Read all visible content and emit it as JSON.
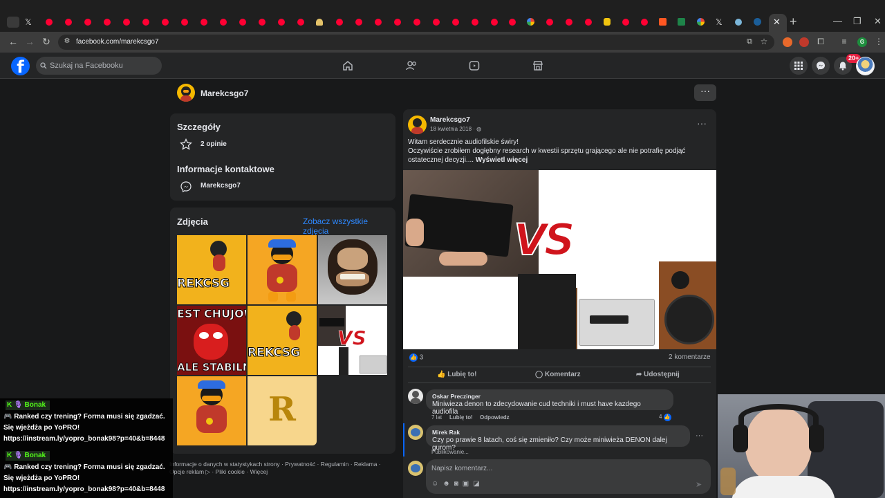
{
  "browser": {
    "url": "facebook.com/marekcsgo7",
    "extensions_badge": "G"
  },
  "facebook": {
    "search_placeholder": "Szukaj na Facebooku",
    "notifications_badge": "20+",
    "accent": "#0866ff"
  },
  "profile": {
    "name": "Marekcsgo7"
  },
  "details": {
    "title": "Szczegóły",
    "reviews": "2 opinie",
    "contact_title": "Informacje kontaktowe",
    "messenger_name": "Marekcsgo7"
  },
  "photos": {
    "title": "Zdjęcia",
    "see_all": "Zobacz wszystkie zdjęcia",
    "tile_texts": [
      "REKCSG",
      "EST CHUJOW",
      "ALE STABILNI",
      "REKCSG",
      "R",
      "VS"
    ]
  },
  "footer": {
    "line1": "Informacje o danych w statystykach strony · Prywatność · Regulamin · Reklama ·",
    "line2": "Opcje reklam ▷ · Pliki cookie · Więcej"
  },
  "post": {
    "author": "Marekcsgo7",
    "date": "18 kwietnia 2018 ·",
    "text1": "Witam serdecznie audiofilskie świry!",
    "text2": "Oczywiście zrobiłem dogłębny research w kwestii sprzętu grającego ale nie potrafię podjąć ostatecznej decyzji....",
    "see_more": "Wyświetl więcej",
    "image_text": "VS",
    "reaction_count": "3",
    "comment_count": "2 komentarze",
    "like": "Lubię to!",
    "comment": "Komentarz",
    "share": "Udostępnij"
  },
  "comments": [
    {
      "name": "Oskar Preczinger",
      "text": "Miniwieza denon to zdecydowanie cud techniki i must have kazdego audiofila",
      "time": "7 lat",
      "like": "Lubię to!",
      "reply": "Odpowiedz",
      "reactions": "4"
    },
    {
      "name": "Mirek Rak",
      "text": "Czy po prawie 8 latach, coś się zmieniło? Czy może miniwieża DENON dalej gurom?",
      "status": "Publikowanie..."
    }
  ],
  "composer": {
    "placeholder": "Napisz komentarz..."
  },
  "chat": [
    {
      "user": "Bonak",
      "message": "Ranked czy trening? Forma musi się zgadzać. Się wjeżdża po YoPRO! https://instream.ly/yopro_bonak98?p=40&b=8448"
    },
    {
      "user": "Bonak",
      "message": "Ranked czy trening? Forma musi się zgadzać. Się wjeżdża po YoPRO! https://instream.ly/yopro_bonak98?p=40&b=8448"
    }
  ]
}
